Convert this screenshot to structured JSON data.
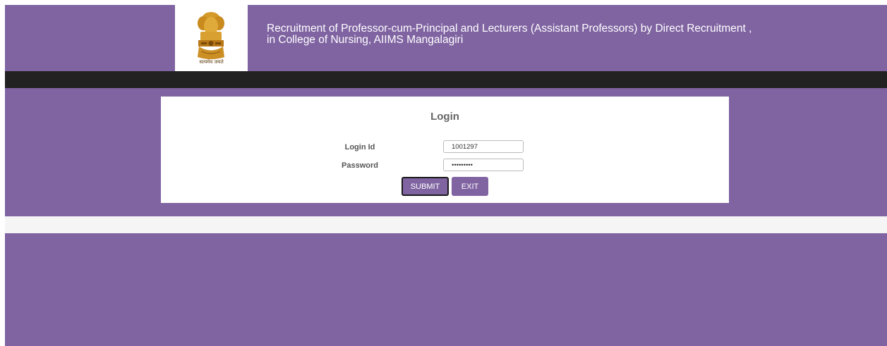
{
  "header": {
    "title": "Recruitment of Professor-cum-Principal and Lecturers (Assistant Professors) by Direct Recruitment , in College of Nursing, AIIMS Mangalagiri",
    "emblem_motto": "सत्यमेव जयते",
    "emblem_icon": "national-emblem-icon"
  },
  "login": {
    "title": "Login",
    "login_id_label": "Login Id",
    "login_id_value": "1001297",
    "password_label": "Password",
    "password_value": "•••••••••",
    "submit_label": "SUBMIT",
    "exit_label": "EXIT"
  },
  "colors": {
    "brand_purple": "#8064a2",
    "navbar": "#222222",
    "strip": "#f5f5f5"
  }
}
